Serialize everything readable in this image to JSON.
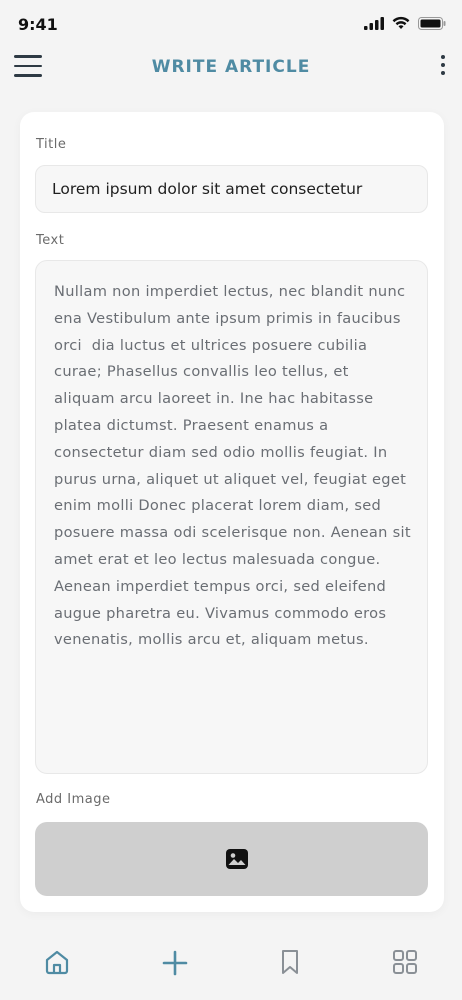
{
  "status_bar": {
    "time": "9:41",
    "icons": [
      "signal-icon",
      "wifi-icon",
      "battery-icon"
    ]
  },
  "header": {
    "title": "WRITE ARTICLE",
    "menu_icon": "hamburger-menu-icon",
    "more_icon": "more-vertical-icon"
  },
  "form": {
    "title_label": "Title",
    "title_value": "Lorem ipsum dolor sit amet consectetur",
    "text_label": "Text",
    "text_value": "Nullam non imperdiet lectus, nec blandit nunc ena Vestibulum ante ipsum primis in faucibus orci  dia luctus et ultrices posuere cubilia curae; Phasellus convallis leo tellus, et aliquam arcu laoreet in. Ine hac habitasse platea dictumst. Praesent enamus a consectetur diam sed odio mollis feugiat. In purus urna, aliquet ut aliquet vel, feugiat eget enim molli Donec placerat lorem diam, sed posuere massa odi scelerisque non. Aenean sit amet erat et leo lectus malesuada congue. Aenean imperdiet tempus orci, sed eleifend augue pharetra eu. Vivamus commodo eros venenatis, mollis arcu et, aliquam metus.",
    "image_label": "Add Image",
    "image_icon": "image-icon"
  },
  "bottom_nav": {
    "items": [
      {
        "icon": "home-icon",
        "active": true
      },
      {
        "icon": "add-icon",
        "active": false
      },
      {
        "icon": "bookmark-icon",
        "active": false
      },
      {
        "icon": "grid-icon",
        "active": false
      }
    ]
  },
  "colors": {
    "accent": "#4f8ba3",
    "background": "#f4f4f4",
    "card": "#ffffff",
    "input_bg": "#f7f7f7",
    "image_placeholder": "#cfcfcf",
    "icon_dark": "#2e3a44",
    "icon_muted": "#8a9096"
  }
}
